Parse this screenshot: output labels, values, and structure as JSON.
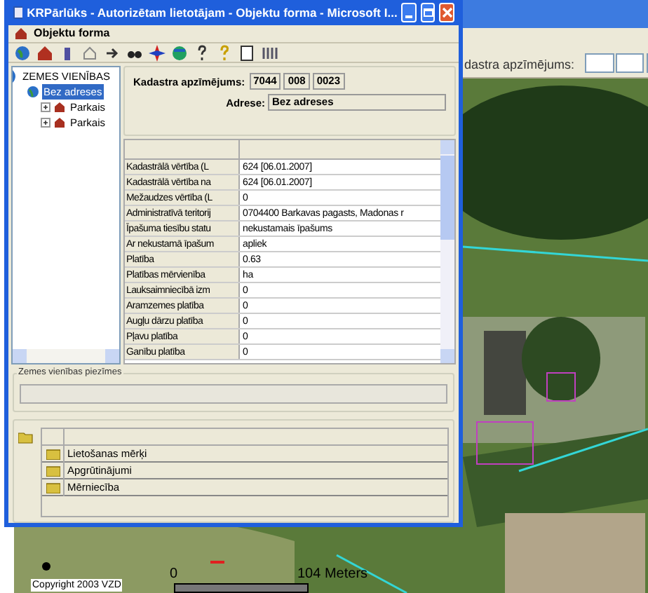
{
  "background_window": {
    "field_label": "dastra apzīmējums:"
  },
  "map": {
    "kind": "picture",
    "copyright": "Copyright 2003 VZD",
    "scale_start": "0",
    "scale_end": "104 Meters"
  },
  "window": {
    "title": "KRPārlūks - Autorizētam lietotājam - Objektu forma - Microsoft I...",
    "form_title": "Objektu forma"
  },
  "tree": [
    {
      "label": "ZEMES VIENĪBAS",
      "selected": false,
      "children": [
        {
          "label": "Bez adreses",
          "selected": true,
          "children": [
            {
              "label": "Parkais",
              "selected": false,
              "expanded": false
            },
            {
              "label": "Parkais",
              "selected": false,
              "expanded": false
            }
          ]
        }
      ]
    }
  ],
  "kadastra": {
    "label": "Kadastra apzīmējums:",
    "parts": [
      "7044",
      "008",
      "0023"
    ]
  },
  "adrese": {
    "label": "Adrese:",
    "value": "Bez adreses"
  },
  "properties": [
    {
      "name": "Kadastrālā vērtība (L",
      "value": "624 [06.01.2007]"
    },
    {
      "name": "Kadastrālā vērtība na",
      "value": "624 [06.01.2007]"
    },
    {
      "name": "Mežaudzes vērtība (L",
      "value": "0"
    },
    {
      "name": "Administratīvā teritorij",
      "value": "0704400 Barkavas pagasts, Madonas r"
    },
    {
      "name": "Īpašuma tiesību statu",
      "value": "nekustamais īpašums"
    },
    {
      "name": "Ar nekustamā īpašum",
      "value": "apliek"
    },
    {
      "name": "Platība",
      "value": "0.63"
    },
    {
      "name": "Platības mērvienība",
      "value": "ha"
    },
    {
      "name": "Lauksaimniecībā izm",
      "value": "0"
    },
    {
      "name": "Aramzemes platība",
      "value": "0"
    },
    {
      "name": "Augļu dārzu platība",
      "value": "0"
    },
    {
      "name": "Pļavu platība",
      "value": "0"
    },
    {
      "name": "Ganību platība",
      "value": "0"
    }
  ],
  "notes": {
    "label": "Zemes vienības piezīmes"
  },
  "sublist": [
    {
      "label": "Lietošanas mērķi"
    },
    {
      "label": "Apgrūtinājumi"
    },
    {
      "label": "Mērniecība"
    }
  ]
}
